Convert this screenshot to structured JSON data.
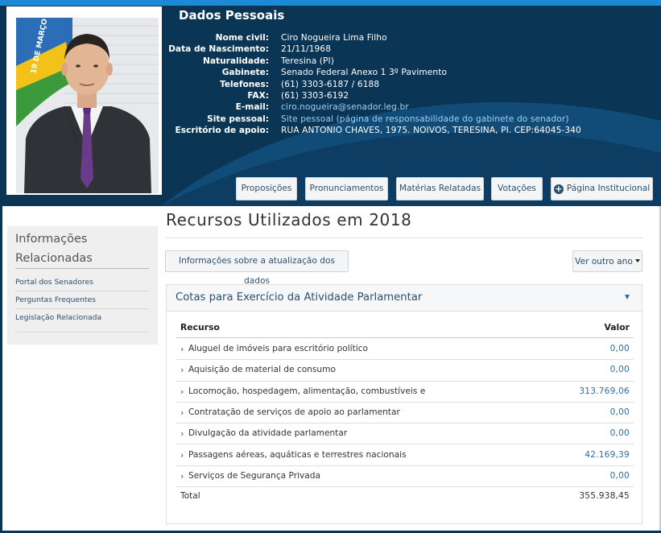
{
  "header": {
    "title": "Dados Pessoais",
    "fields": [
      {
        "label": "Nome civil:",
        "value": "Ciro Nogueira Lima Filho",
        "link": false
      },
      {
        "label": "Data de Nascimento:",
        "value": "21/11/1968",
        "link": false
      },
      {
        "label": "Naturalidade:",
        "value": "Teresina (PI)",
        "link": false
      },
      {
        "label": "Gabinete:",
        "value": "Senado Federal Anexo 1 3º Pavimento",
        "link": false
      },
      {
        "label": "Telefones:",
        "value": "(61) 3303-6187 / 6188",
        "link": false
      },
      {
        "label": "FAX:",
        "value": "(61) 3303-6192",
        "link": false
      },
      {
        "label": "E-mail:",
        "value": "ciro.nogueira@senador.leg.br",
        "link": true
      },
      {
        "label": "Site pessoal:",
        "value": "Site pessoal (página de responsabilidade do gabinete do senador)",
        "link": true
      },
      {
        "label": "Escritório de apoio:",
        "value": "RUA ANTONIO CHAVES, 1975. NOIVOS, TERESINA, PI. CEP:64045-340",
        "link": false
      }
    ],
    "photo_flag_text": "19 DE MARÇO",
    "tabs": [
      "Proposições",
      "Pronunciamentos",
      "Matérias Relatadas",
      "Votações",
      "Página Institucional"
    ]
  },
  "sidebar": {
    "title": "Informações Relacionadas",
    "links": [
      "Portal dos Senadores",
      "Perguntas Frequentes",
      "Legislação Relacionada"
    ]
  },
  "main": {
    "title": "Recursos Utilizados em 2018",
    "info_button": "Informações sobre a atualização dos dados",
    "year_button": "Ver outro ano",
    "panel": {
      "title": "Cotas para Exercício da Atividade Parlamentar",
      "col_resource": "Recurso",
      "col_value": "Valor",
      "rows": [
        {
          "name": "Aluguel de imóveis para escritório político",
          "value": "0,00"
        },
        {
          "name": "Aquisição de material de consumo",
          "value": "0,00"
        },
        {
          "name": "Locomoção, hospedagem, alimentação, combustíveis e",
          "value": "313.769,06"
        },
        {
          "name": "Contratação de serviços de apoio ao parlamentar",
          "value": "0,00"
        },
        {
          "name": "Divulgação da atividade parlamentar",
          "value": "0,00"
        },
        {
          "name": "Passagens aéreas, aquáticas e terrestres nacionais",
          "value": "42.169,39"
        },
        {
          "name": "Serviços de Segurança Privada",
          "value": "0,00"
        }
      ],
      "total_label": "Total",
      "total_value": "355.938,45"
    }
  },
  "colors": {
    "header_bg": "#0b3555",
    "header_curve": "#114c78",
    "accent": "#1c8ad6",
    "link": "#2d6fa3"
  }
}
